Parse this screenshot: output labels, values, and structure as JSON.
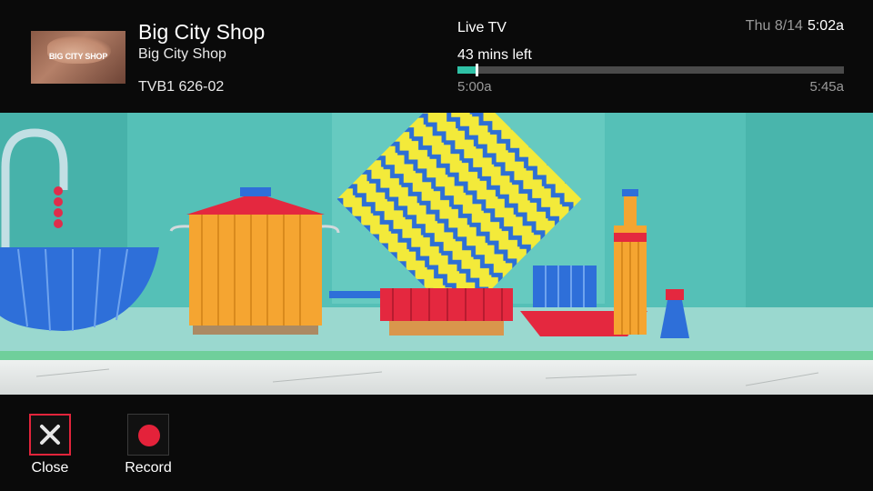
{
  "channel_banner": {
    "thumbnail_text": "BIG CITY SHOP",
    "title": "Big City Shop",
    "subtitle": "Big City Shop",
    "channel": "TVB1 626-02"
  },
  "playback": {
    "source": "Live TV",
    "time_left": "43 mins left",
    "progress_fraction": 0.05,
    "start_time": "5:00a",
    "end_time": "5:45a"
  },
  "clock": {
    "date": "Thu 8/14",
    "time": "5:02a"
  },
  "actions": [
    {
      "label": "Close",
      "icon": "close-icon",
      "focused": true
    },
    {
      "label": "Record",
      "icon": "record-icon",
      "focused": false
    }
  ],
  "colors": {
    "accent": "#2fc1a6",
    "focus_border": "#e2243b",
    "record_red": "#e4223a"
  }
}
